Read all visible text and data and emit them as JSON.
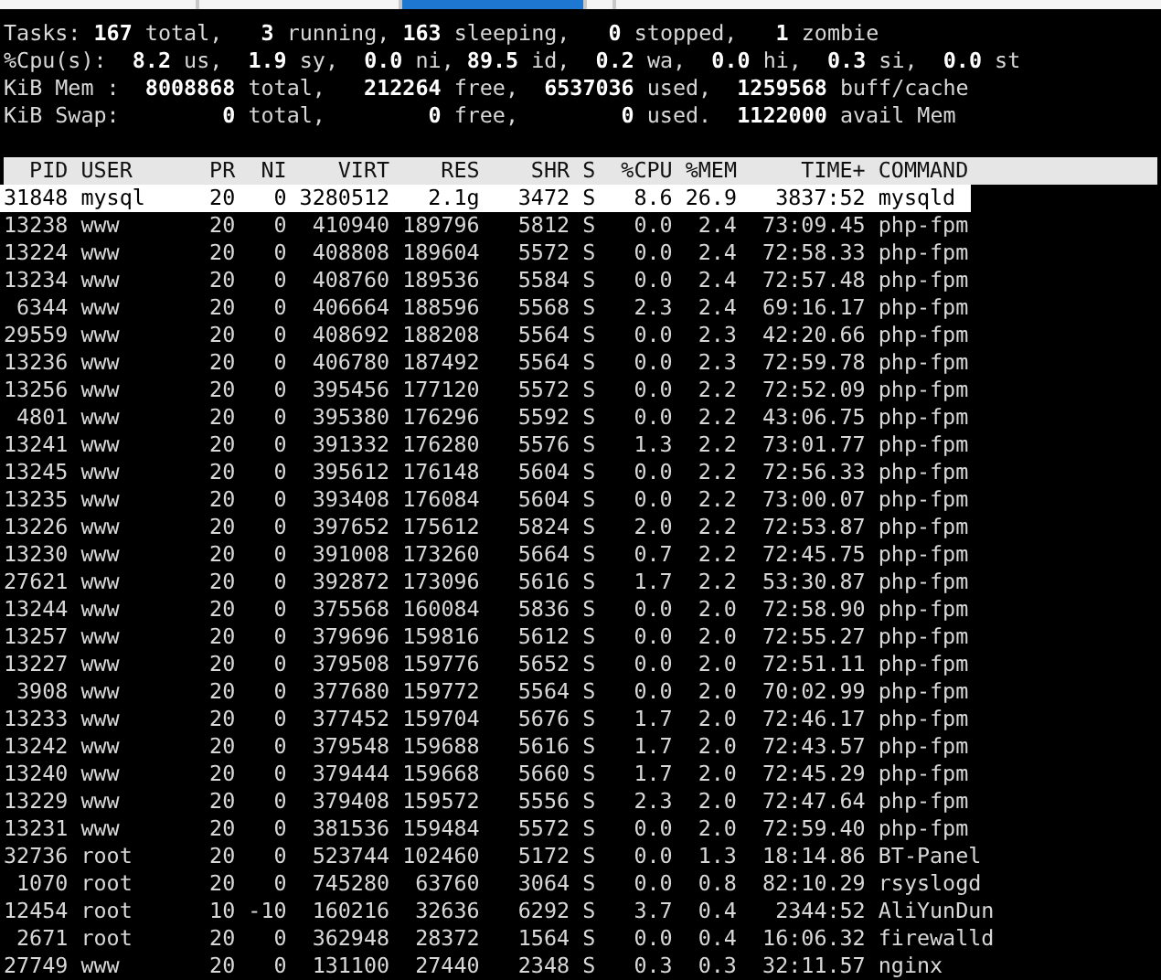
{
  "tabs": [
    {
      "selected": false
    },
    {
      "selected": false
    },
    {
      "selected": true
    },
    {
      "selected": false
    },
    {
      "selected": false
    }
  ],
  "summary": [
    "Tasks: **167** total,   **3** running, **163** sleeping,   **0** stopped,   **1** zombie",
    "%Cpu(s):  **8.2** us,  **1.9** sy,  **0.0** ni, **89.5** id,  **0.2** wa,  **0.0** hi,  **0.3** si,  **0.0** st",
    "KiB Mem :  **8008868** total,   **212264** free,  **6537036** used,  **1259568** buff/cache",
    "KiB Swap:        **0** total,        **0** free,        **0** used.  **1122000** avail Mem"
  ],
  "table": {
    "columns": [
      "PID",
      "USER",
      "PR",
      "NI",
      "VIRT",
      "RES",
      "SHR",
      "S",
      "%CPU",
      "%MEM",
      "TIME+",
      "COMMAND"
    ],
    "rows": [
      {
        "highlighted": true,
        "cells": [
          "31848",
          "mysql",
          "20",
          "0",
          "3280512",
          "2.1g",
          "3472",
          "S",
          "8.6",
          "26.9",
          "3837:52",
          "mysqld"
        ]
      },
      {
        "highlighted": false,
        "cells": [
          "13238",
          "www",
          "20",
          "0",
          "410940",
          "189796",
          "5812",
          "S",
          "0.0",
          "2.4",
          "73:09.45",
          "php-fpm"
        ]
      },
      {
        "highlighted": false,
        "cells": [
          "13224",
          "www",
          "20",
          "0",
          "408808",
          "189604",
          "5572",
          "S",
          "0.0",
          "2.4",
          "72:58.33",
          "php-fpm"
        ]
      },
      {
        "highlighted": false,
        "cells": [
          "13234",
          "www",
          "20",
          "0",
          "408760",
          "189536",
          "5584",
          "S",
          "0.0",
          "2.4",
          "72:57.48",
          "php-fpm"
        ]
      },
      {
        "highlighted": false,
        "cells": [
          "6344",
          "www",
          "20",
          "0",
          "406664",
          "188596",
          "5568",
          "S",
          "2.3",
          "2.4",
          "69:16.17",
          "php-fpm"
        ]
      },
      {
        "highlighted": false,
        "cells": [
          "29559",
          "www",
          "20",
          "0",
          "408692",
          "188208",
          "5564",
          "S",
          "0.0",
          "2.3",
          "42:20.66",
          "php-fpm"
        ]
      },
      {
        "highlighted": false,
        "cells": [
          "13236",
          "www",
          "20",
          "0",
          "406780",
          "187492",
          "5564",
          "S",
          "0.0",
          "2.3",
          "72:59.78",
          "php-fpm"
        ]
      },
      {
        "highlighted": false,
        "cells": [
          "13256",
          "www",
          "20",
          "0",
          "395456",
          "177120",
          "5572",
          "S",
          "0.0",
          "2.2",
          "72:52.09",
          "php-fpm"
        ]
      },
      {
        "highlighted": false,
        "cells": [
          "4801",
          "www",
          "20",
          "0",
          "395380",
          "176296",
          "5592",
          "S",
          "0.0",
          "2.2",
          "43:06.75",
          "php-fpm"
        ]
      },
      {
        "highlighted": false,
        "cells": [
          "13241",
          "www",
          "20",
          "0",
          "391332",
          "176280",
          "5576",
          "S",
          "1.3",
          "2.2",
          "73:01.77",
          "php-fpm"
        ]
      },
      {
        "highlighted": false,
        "cells": [
          "13245",
          "www",
          "20",
          "0",
          "395612",
          "176148",
          "5604",
          "S",
          "0.0",
          "2.2",
          "72:56.33",
          "php-fpm"
        ]
      },
      {
        "highlighted": false,
        "cells": [
          "13235",
          "www",
          "20",
          "0",
          "393408",
          "176084",
          "5604",
          "S",
          "0.0",
          "2.2",
          "73:00.07",
          "php-fpm"
        ]
      },
      {
        "highlighted": false,
        "cells": [
          "13226",
          "www",
          "20",
          "0",
          "397652",
          "175612",
          "5824",
          "S",
          "2.0",
          "2.2",
          "72:53.87",
          "php-fpm"
        ]
      },
      {
        "highlighted": false,
        "cells": [
          "13230",
          "www",
          "20",
          "0",
          "391008",
          "173260",
          "5664",
          "S",
          "0.7",
          "2.2",
          "72:45.75",
          "php-fpm"
        ]
      },
      {
        "highlighted": false,
        "cells": [
          "27621",
          "www",
          "20",
          "0",
          "392872",
          "173096",
          "5616",
          "S",
          "1.7",
          "2.2",
          "53:30.87",
          "php-fpm"
        ]
      },
      {
        "highlighted": false,
        "cells": [
          "13244",
          "www",
          "20",
          "0",
          "375568",
          "160084",
          "5836",
          "S",
          "0.0",
          "2.0",
          "72:58.90",
          "php-fpm"
        ]
      },
      {
        "highlighted": false,
        "cells": [
          "13257",
          "www",
          "20",
          "0",
          "379696",
          "159816",
          "5612",
          "S",
          "0.0",
          "2.0",
          "72:55.27",
          "php-fpm"
        ]
      },
      {
        "highlighted": false,
        "cells": [
          "13227",
          "www",
          "20",
          "0",
          "379508",
          "159776",
          "5652",
          "S",
          "0.0",
          "2.0",
          "72:51.11",
          "php-fpm"
        ]
      },
      {
        "highlighted": false,
        "cells": [
          "3908",
          "www",
          "20",
          "0",
          "377680",
          "159772",
          "5564",
          "S",
          "0.0",
          "2.0",
          "70:02.99",
          "php-fpm"
        ]
      },
      {
        "highlighted": false,
        "cells": [
          "13233",
          "www",
          "20",
          "0",
          "377452",
          "159704",
          "5676",
          "S",
          "1.7",
          "2.0",
          "72:46.17",
          "php-fpm"
        ]
      },
      {
        "highlighted": false,
        "cells": [
          "13242",
          "www",
          "20",
          "0",
          "379548",
          "159688",
          "5616",
          "S",
          "1.7",
          "2.0",
          "72:43.57",
          "php-fpm"
        ]
      },
      {
        "highlighted": false,
        "cells": [
          "13240",
          "www",
          "20",
          "0",
          "379444",
          "159668",
          "5660",
          "S",
          "1.7",
          "2.0",
          "72:45.29",
          "php-fpm"
        ]
      },
      {
        "highlighted": false,
        "cells": [
          "13229",
          "www",
          "20",
          "0",
          "379408",
          "159572",
          "5556",
          "S",
          "2.3",
          "2.0",
          "72:47.64",
          "php-fpm"
        ]
      },
      {
        "highlighted": false,
        "cells": [
          "13231",
          "www",
          "20",
          "0",
          "381536",
          "159484",
          "5572",
          "S",
          "0.0",
          "2.0",
          "72:59.40",
          "php-fpm"
        ]
      },
      {
        "highlighted": false,
        "cells": [
          "32736",
          "root",
          "20",
          "0",
          "523744",
          "102460",
          "5172",
          "S",
          "0.0",
          "1.3",
          "18:14.86",
          "BT-Panel"
        ]
      },
      {
        "highlighted": false,
        "cells": [
          "1070",
          "root",
          "20",
          "0",
          "745280",
          "63760",
          "3064",
          "S",
          "0.0",
          "0.8",
          "82:10.29",
          "rsyslogd"
        ]
      },
      {
        "highlighted": false,
        "cells": [
          "12454",
          "root",
          "10",
          "-10",
          "160216",
          "32636",
          "6292",
          "S",
          "3.7",
          "0.4",
          "2344:52",
          "AliYunDun"
        ]
      },
      {
        "highlighted": false,
        "cells": [
          "2671",
          "root",
          "20",
          "0",
          "362948",
          "28372",
          "1564",
          "S",
          "0.0",
          "0.4",
          "16:06.32",
          "firewalld"
        ]
      },
      {
        "highlighted": false,
        "cells": [
          "27749",
          "www",
          "20",
          "0",
          "131100",
          "27440",
          "2348",
          "S",
          "0.3",
          "0.3",
          "32:11.57",
          "nginx"
        ]
      }
    ]
  }
}
